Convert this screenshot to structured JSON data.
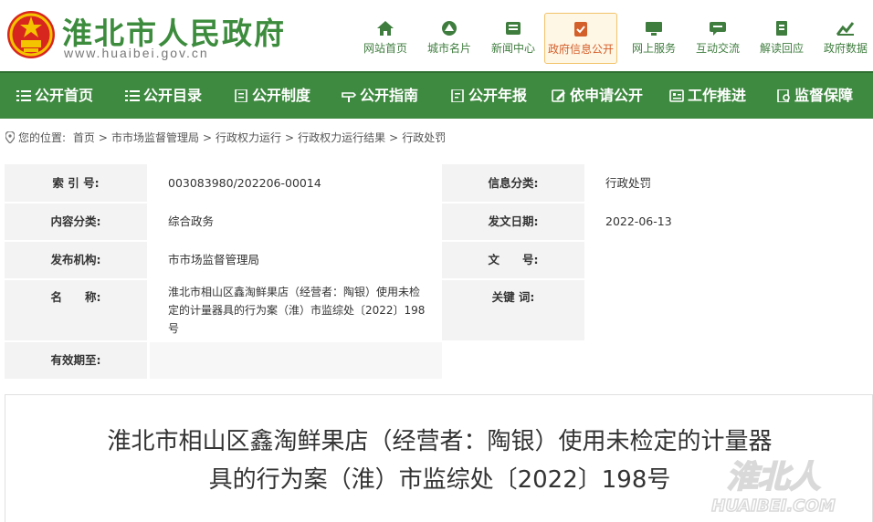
{
  "header": {
    "site_title": "淮北市人民政府",
    "site_url": "www.huaibei.gov.cn"
  },
  "top_nav": [
    {
      "label": "网站首页",
      "icon": "home-icon"
    },
    {
      "label": "城市名片",
      "icon": "city-card-icon"
    },
    {
      "label": "新闻中心",
      "icon": "news-icon"
    },
    {
      "label": "政府信息公开",
      "icon": "gov-info-icon",
      "active": true
    },
    {
      "label": "网上服务",
      "icon": "monitor-icon"
    },
    {
      "label": "互动交流",
      "icon": "chat-icon"
    },
    {
      "label": "解读回应",
      "icon": "document-icon"
    },
    {
      "label": "政府数据",
      "icon": "data-chart-icon"
    }
  ],
  "main_nav": [
    {
      "label": "公开首页",
      "icon": "list-icon"
    },
    {
      "label": "公开目录",
      "icon": "list-icon"
    },
    {
      "label": "公开制度",
      "icon": "file-icon"
    },
    {
      "label": "公开指南",
      "icon": "guide-icon"
    },
    {
      "label": "公开年报",
      "icon": "report-icon"
    },
    {
      "label": "依申请公开",
      "icon": "edit-icon"
    },
    {
      "label": "工作推进",
      "icon": "progress-icon"
    },
    {
      "label": "监督保障",
      "icon": "shield-icon"
    }
  ],
  "breadcrumb": {
    "prefix": "您的位置:",
    "items": [
      "首页",
      "市市场监督管理局",
      "行政权力运行",
      "行政权力运行结果",
      "行政处罚"
    ]
  },
  "info": {
    "index_label": "索 引 号:",
    "index_value": "003083980/202206-00014",
    "category_label": "信息分类:",
    "category_value": "行政处罚",
    "content_label": "内容分类:",
    "content_value": "综合政务",
    "date_label": "发文日期:",
    "date_value": "2022-06-13",
    "org_label": "发布机构:",
    "org_value": "市市场监督管理局",
    "docno_label": "文　　号:",
    "docno_value": "",
    "name_label": "名　　称:",
    "name_value_line1": "淮北市相山区鑫淘鲜果店（经营者：陶银）使用未检",
    "name_value_line2": "定的计量器具的行为案（淮）市监综处〔2022〕198",
    "name_value_line3": "号",
    "keywords_label": "关键 词:",
    "keywords_value": "",
    "valid_label": "有效期至:",
    "valid_value": ""
  },
  "article": {
    "title_line1": "淮北市相山区鑫淘鲜果店（经营者：陶银）使用未检定的计量器",
    "title_line2": "具的行为案（淮）市监综处〔2022〕198号"
  },
  "watermark": {
    "text": "淮北人",
    "subtext": "HUAIBEI.COM"
  },
  "colors": {
    "brand_green": "#3f8a41",
    "active_orange": "#d35f2a"
  }
}
